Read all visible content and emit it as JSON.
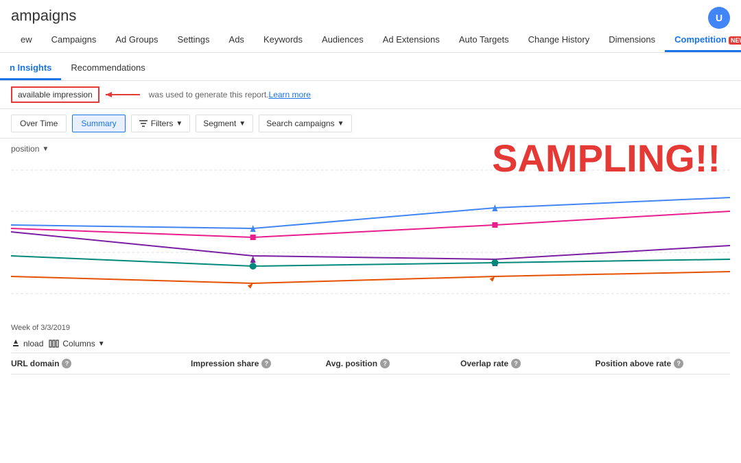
{
  "header": {
    "title": "ampaigns",
    "user_button": "U"
  },
  "nav": {
    "tabs": [
      {
        "label": "ew",
        "active": false
      },
      {
        "label": "Campaigns",
        "active": false
      },
      {
        "label": "Ad Groups",
        "active": false
      },
      {
        "label": "Settings",
        "active": false
      },
      {
        "label": "Ads",
        "active": false
      },
      {
        "label": "Keywords",
        "active": false
      },
      {
        "label": "Audiences",
        "active": false
      },
      {
        "label": "Ad Extensions",
        "active": false
      },
      {
        "label": "Auto Targets",
        "active": false
      },
      {
        "label": "Change History",
        "active": false
      },
      {
        "label": "Dimensions",
        "active": false
      },
      {
        "label": "Competition",
        "active": true,
        "badge": "NEW:"
      }
    ]
  },
  "sub_nav": {
    "tabs": [
      {
        "label": "n Insights",
        "active": true
      },
      {
        "label": "Recommendations",
        "active": false
      }
    ]
  },
  "sampling_banner": {
    "label": "available impression",
    "text": "was used to generate this report.",
    "learn_more": "Learn more"
  },
  "sampling_shout": "SAMPLING!!",
  "toolbar": {
    "over_time_label": "Over Time",
    "summary_label": "Summary",
    "filters_label": "Filters",
    "segment_label": "Segment",
    "search_campaigns_label": "Search campaigns"
  },
  "chart": {
    "subtitle": "position",
    "week_label": "Week of 3/3/2019",
    "grid_lines": [
      0,
      25,
      50,
      75,
      100
    ]
  },
  "table": {
    "download_label": "nload",
    "columns_label": "Columns",
    "headers": [
      {
        "label": "URL domain",
        "has_info": true
      },
      {
        "label": "Impression share",
        "has_info": true
      },
      {
        "label": "Avg. position",
        "has_info": true
      },
      {
        "label": "Overlap rate",
        "has_info": true
      },
      {
        "label": "Position above rate",
        "has_info": true
      }
    ]
  }
}
